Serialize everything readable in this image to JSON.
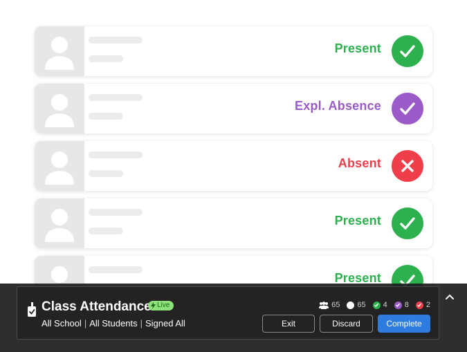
{
  "students": [
    {
      "status": "Present",
      "variant": "present"
    },
    {
      "status": "Expl. Absence",
      "variant": "excused"
    },
    {
      "status": "Absent",
      "variant": "absent"
    },
    {
      "status": "Present",
      "variant": "present"
    },
    {
      "status": "Present",
      "variant": "present"
    }
  ],
  "footer": {
    "title": "Class Attendance",
    "live_label": "Live",
    "filters": [
      "All School",
      "All Students",
      "Signed All"
    ],
    "counts": {
      "total": "65",
      "unmarked": "65",
      "present": "4",
      "excused": "8",
      "absent": "2"
    },
    "buttons": {
      "exit": "Exit",
      "discard": "Discard",
      "complete": "Complete"
    }
  },
  "colors": {
    "present": "#2db04e",
    "excused": "#9a5bc9",
    "absent": "#ef3e4a",
    "primary": "#2f7ce0"
  }
}
